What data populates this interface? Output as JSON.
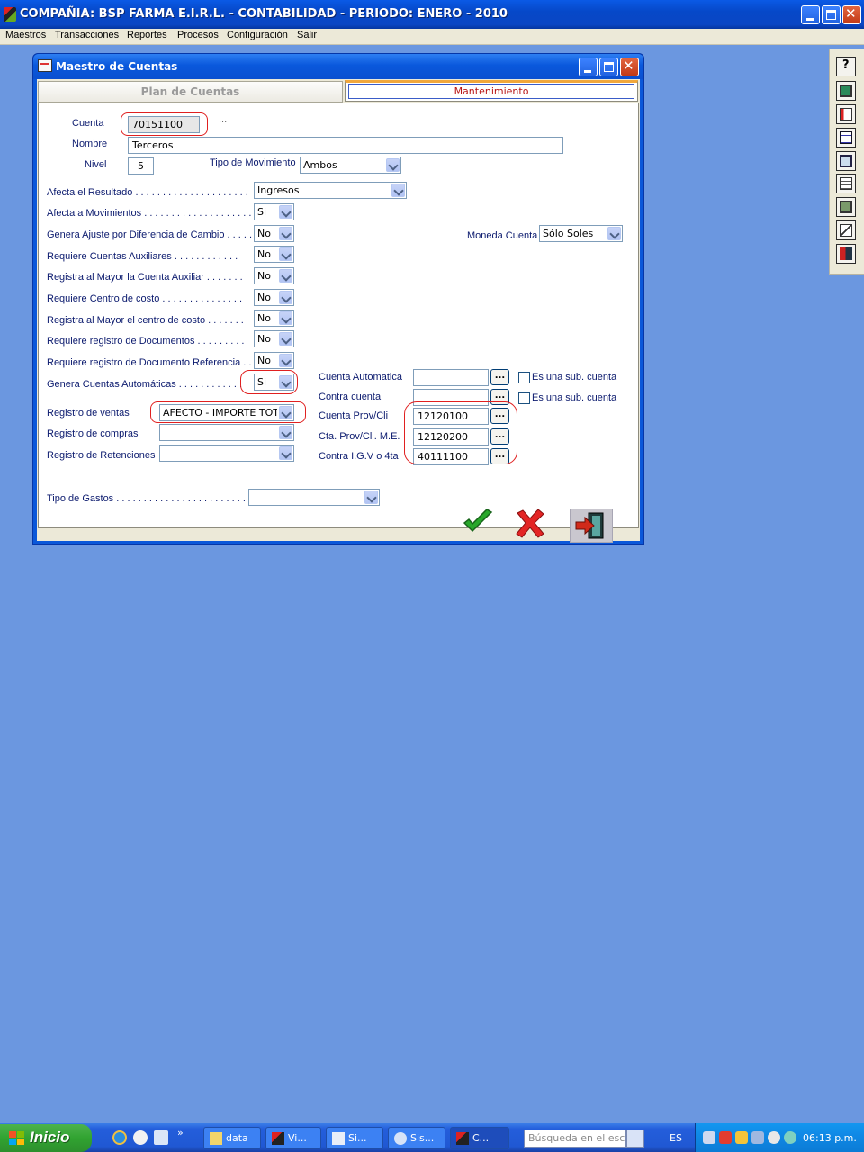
{
  "app": {
    "title": "COMPAÑIA:  BSP FARMA E.I.R.L.   -   CONTABILIDAD   -    PERIODO: ENERO - 2010"
  },
  "menu": [
    "Maestros",
    "Transacciones",
    "Reportes",
    "Procesos",
    "Configuración",
    "Salir"
  ],
  "right_toolbar": [
    "help-icon",
    "monitor-icon",
    "table-add-icon",
    "grid-icon",
    "windows-icon",
    "edit-icon",
    "calculator-icon",
    "chart-icon",
    "exit-door-icon"
  ],
  "window": {
    "title": "Maestro de Cuentas",
    "tabs": [
      "Plan de Cuentas",
      "Mantenimiento"
    ]
  },
  "form": {
    "cuenta_label": "Cuenta",
    "cuenta_value": "70151100",
    "cuenta_lookup": "...",
    "nombre_label": "Nombre",
    "nombre_value": "Terceros",
    "nivel_label": "Nivel",
    "nivel_value": "5",
    "tipo_mov_label": "Tipo de Movimiento",
    "tipo_mov_value": "Ambos",
    "afecta_resultado_label": "Afecta el  Resultado . . . . . . . . . . . . . . . . . . . . .",
    "afecta_resultado_value": "Ingresos",
    "afecta_mov_label": "Afecta a Movimientos . . . . . . . . . . . . . . . . . . . .",
    "afecta_mov_value": "Si",
    "genera_ajuste_label": "Genera Ajuste por Diferencia de Cambio . . . . .",
    "genera_ajuste_value": "No",
    "moneda_label": "Moneda Cuenta",
    "moneda_value": "Sólo Soles",
    "req_aux_label": "Requiere Cuentas Auxiliares . . . . . . . . . . . .",
    "req_aux_value": "No",
    "reg_mayor_aux_label": "Registra al Mayor la Cuenta Auxiliar . . . . . . .",
    "reg_mayor_aux_value": "No",
    "req_cc_label": "Requiere Centro de costo . . . . . . . . . . . . . . .",
    "req_cc_value": "No",
    "reg_mayor_cc_label": "Registra al Mayor el centro de costo . . . . . . .",
    "reg_mayor_cc_value": "No",
    "req_doc_label": "Requiere registro de Documentos . . . . . . . . .",
    "req_doc_value": "No",
    "req_docref_label": "Requiere registro de Documento Referencia . .",
    "req_docref_value": "No",
    "genera_auto_label": "Genera Cuentas Automáticas . . . . . . . . . . . .",
    "genera_auto_value": "Si",
    "cuenta_auto_label": "Cuenta Automatica",
    "cuenta_auto_value": "",
    "contra_cuenta_label": "Contra cuenta",
    "contra_cuenta_value": "",
    "subcuenta_label": "Es una sub. cuenta",
    "subcuenta2_label": "Es una sub. cuenta",
    "reg_ventas_label": "Registro de ventas",
    "reg_ventas_value": "AFECTO - IMPORTE TOTAL",
    "reg_compras_label": "Registro de compras",
    "reg_compras_value": "",
    "reg_ret_label": "Registro de Retenciones",
    "reg_ret_value": "",
    "cta_provcli_label": "Cuenta Prov/Cli",
    "cta_provcli_value": "12120100",
    "cta_provcli_me_label": "Cta. Prov/Cli. M.E.",
    "cta_provcli_me_value": "12120200",
    "contra_igv_label": "Contra I.G.V o 4ta",
    "contra_igv_value": "40111100",
    "tipo_gastos_label": "Tipo de Gastos . . . . . . . . . . . . . . . . . . . . . . . . . .",
    "tipo_gastos_value": "",
    "lookup": "..."
  },
  "taskbar": {
    "start": "Inicio",
    "tasks": [
      "data",
      "Vi...",
      "Si...",
      "Sis...",
      "C..."
    ],
    "search_placeholder": "Búsqueda en el escritorio",
    "lang": "ES",
    "clock": "06:13 p.m."
  },
  "colors": {
    "desktop": "#6b97e0",
    "titlebar": "#0a58dc",
    "label_text": "#0b1a6e",
    "highlight_ring": "#e02020",
    "active_tab_text": "#b81414"
  }
}
